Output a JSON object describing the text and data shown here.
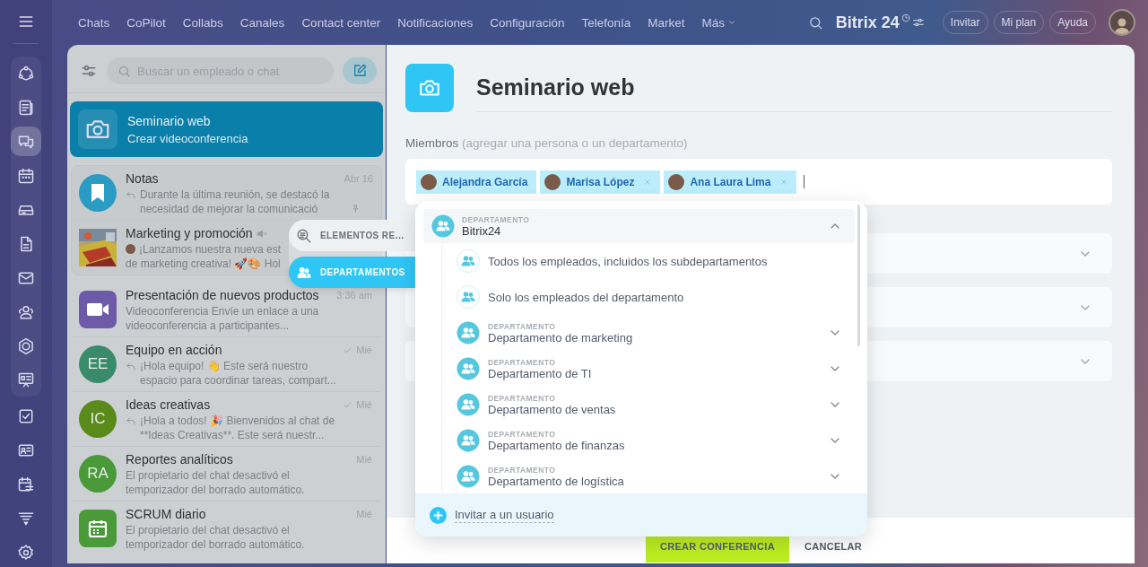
{
  "rail": {
    "items": [
      {
        "selected": false
      },
      {
        "selected": false
      },
      {
        "selected": true
      },
      {
        "selected": false
      },
      {
        "selected": false
      },
      {
        "selected": false
      },
      {
        "selected": false
      },
      {
        "selected": false
      },
      {
        "selected": false
      },
      {
        "selected": false
      },
      {
        "selected": false
      },
      {
        "selected": false
      },
      {
        "selected": false
      },
      {
        "selected": false
      },
      {
        "selected": false
      }
    ]
  },
  "top_nav": {
    "items": [
      "Chats",
      "CoPilot",
      "Collabs",
      "Canales",
      "Contact center",
      "Notificaciones",
      "Configuración",
      "Telefonía",
      "Market"
    ],
    "more": "Más",
    "brand": "Bitrix 24",
    "buttons": [
      "Invitar",
      "Mi plan",
      "Ayuda"
    ]
  },
  "chat_list": {
    "search": {
      "placeholder": "Buscar un empleado o chat"
    },
    "new_chat": {
      "title": "Seminario web",
      "subtitle": "Crear videoconferencia",
      "selected": true
    },
    "chats": [
      {
        "title": "Notas",
        "preview": "Durante la última reunión, se destacó la necesidad de mejorar la comunicació",
        "time": "Abr 16",
        "avatar": {
          "kind": "bookmark",
          "color": "#2a9bc3"
        },
        "pinned": true,
        "muted": false,
        "read": false,
        "reply": true,
        "sender": false
      },
      {
        "title": "Marketing y promoción",
        "preview": "¡Lanzamos nuestra nueva est",
        "preview_2": "de marketing creativa! 🚀🎨 Hol",
        "pinned": true,
        "muted": true,
        "read": false,
        "reply": false,
        "sender": true
      },
      {
        "title": "Presentación de nuevos productos",
        "preview": "Videoconferencia Envíe un enlace a una videoconferencia a participantes...",
        "time": "3:36 am",
        "avatar": {
          "kind": "video",
          "color": "#6d5aa8"
        },
        "pinned": false,
        "muted": false,
        "read": false,
        "reply": false,
        "sender": false
      },
      {
        "title": "Equipo en acción",
        "preview": "¡Hola equipo! 👋 Este será nuestro espacio para coordinar tareas, compart...",
        "time": "Mié",
        "avatar": {
          "kind": "initials",
          "text": "EE",
          "color": "#3a8a6c"
        },
        "pinned": false,
        "muted": false,
        "read": true,
        "reply": true,
        "sender": false
      },
      {
        "title": "Ideas creativas",
        "preview": "¡Hola a todos! 🎉 Bienvenidos al chat de **Ideas Creativas**. Este será nuestr...",
        "time": "Mié",
        "avatar": {
          "kind": "initials",
          "text": "IC",
          "color": "#5a8a1a"
        },
        "pinned": false,
        "muted": false,
        "read": true,
        "reply": true,
        "sender": false
      },
      {
        "title": "Reportes analíticos",
        "preview": "El propietario del chat desactivó el temporizador del borrado automático.",
        "time": "Mié",
        "avatar": {
          "kind": "initials",
          "text": "RA",
          "color": "#4a9a3a"
        },
        "pinned": false,
        "muted": false,
        "read": false,
        "reply": false,
        "sender": false
      },
      {
        "title": "SCRUM diario",
        "preview": "El propietario del chat desactivó el temporizador del borrado automático.",
        "time": "Mié",
        "avatar": {
          "kind": "calendar",
          "color": "#4a9a3a"
        },
        "pinned": false,
        "muted": false,
        "read": false,
        "reply": false,
        "sender": false
      }
    ]
  },
  "conference": {
    "title": "Seminario web",
    "members_label": "Miembros",
    "members_hint": "(agregar una persona o un departamento)",
    "members": [
      {
        "name": "Alejandra García",
        "removable": false
      },
      {
        "name": "Marisa López",
        "removable": true
      },
      {
        "name": "Ana Laura Lima",
        "removable": true
      }
    ],
    "sections": [
      {
        "expanded": false
      },
      {
        "expanded": false
      },
      {
        "expanded": false
      }
    ],
    "create_button": "CREAR CONFERENCIA",
    "cancel_button": "CANCELAR"
  },
  "selector": {
    "tabs": [
      {
        "label": "ELEMENTOS RE…",
        "selected": false
      },
      {
        "label": "DEPARTAMENTOS",
        "selected": true
      }
    ],
    "tree": [
      {
        "kind": "department",
        "caption": "DEPARTAMENTO",
        "name": "Bitrix24",
        "expanded": true,
        "children": [
          {
            "kind": "option",
            "name": "Todos los empleados, incluidos los subdepartamentos"
          },
          {
            "kind": "option",
            "name": "Solo los empleados del departamento"
          },
          {
            "kind": "department",
            "caption": "DEPARTAMENTO",
            "name": "Departamento de marketing",
            "expanded": false
          },
          {
            "kind": "department",
            "caption": "DEPARTAMENTO",
            "name": "Departamento de TI",
            "expanded": false
          },
          {
            "kind": "department",
            "caption": "DEPARTAMENTO",
            "name": "Departamento de ventas",
            "expanded": false
          },
          {
            "kind": "department",
            "caption": "DEPARTAMENTO",
            "name": "Departamento de finanzas",
            "expanded": false
          },
          {
            "kind": "department",
            "caption": "DEPARTAMENTO",
            "name": "Departamento de logística",
            "expanded": false
          }
        ]
      }
    ],
    "footer": "Invitar a un usuario"
  }
}
